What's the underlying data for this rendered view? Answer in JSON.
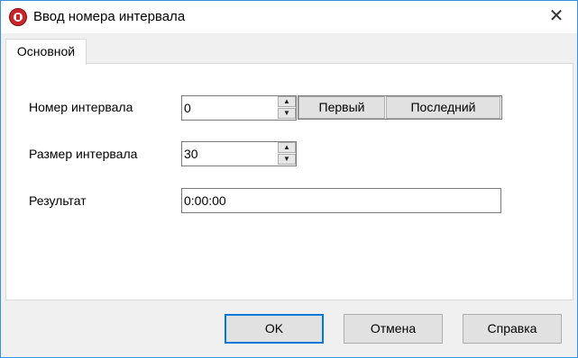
{
  "window": {
    "title": "Ввод номера интервала",
    "close_glyph": "✕"
  },
  "tabs": [
    {
      "label": "Основной",
      "active": true
    }
  ],
  "form": {
    "interval_number": {
      "label": "Номер интервала",
      "value": "0"
    },
    "interval_size": {
      "label": "Размер интервала",
      "value": "30"
    },
    "result": {
      "label": "Результат",
      "value": "0:00:00"
    },
    "first_button": "Первый",
    "last_button": "Последний"
  },
  "spin": {
    "up": "▲",
    "down": "▼"
  },
  "buttons": {
    "ok": "OK",
    "cancel": "Отмена",
    "help": "Справка"
  },
  "colors": {
    "window_border": "#3b8ee0",
    "default_button_border": "#0078d7",
    "app_icon": "#c9252b"
  }
}
